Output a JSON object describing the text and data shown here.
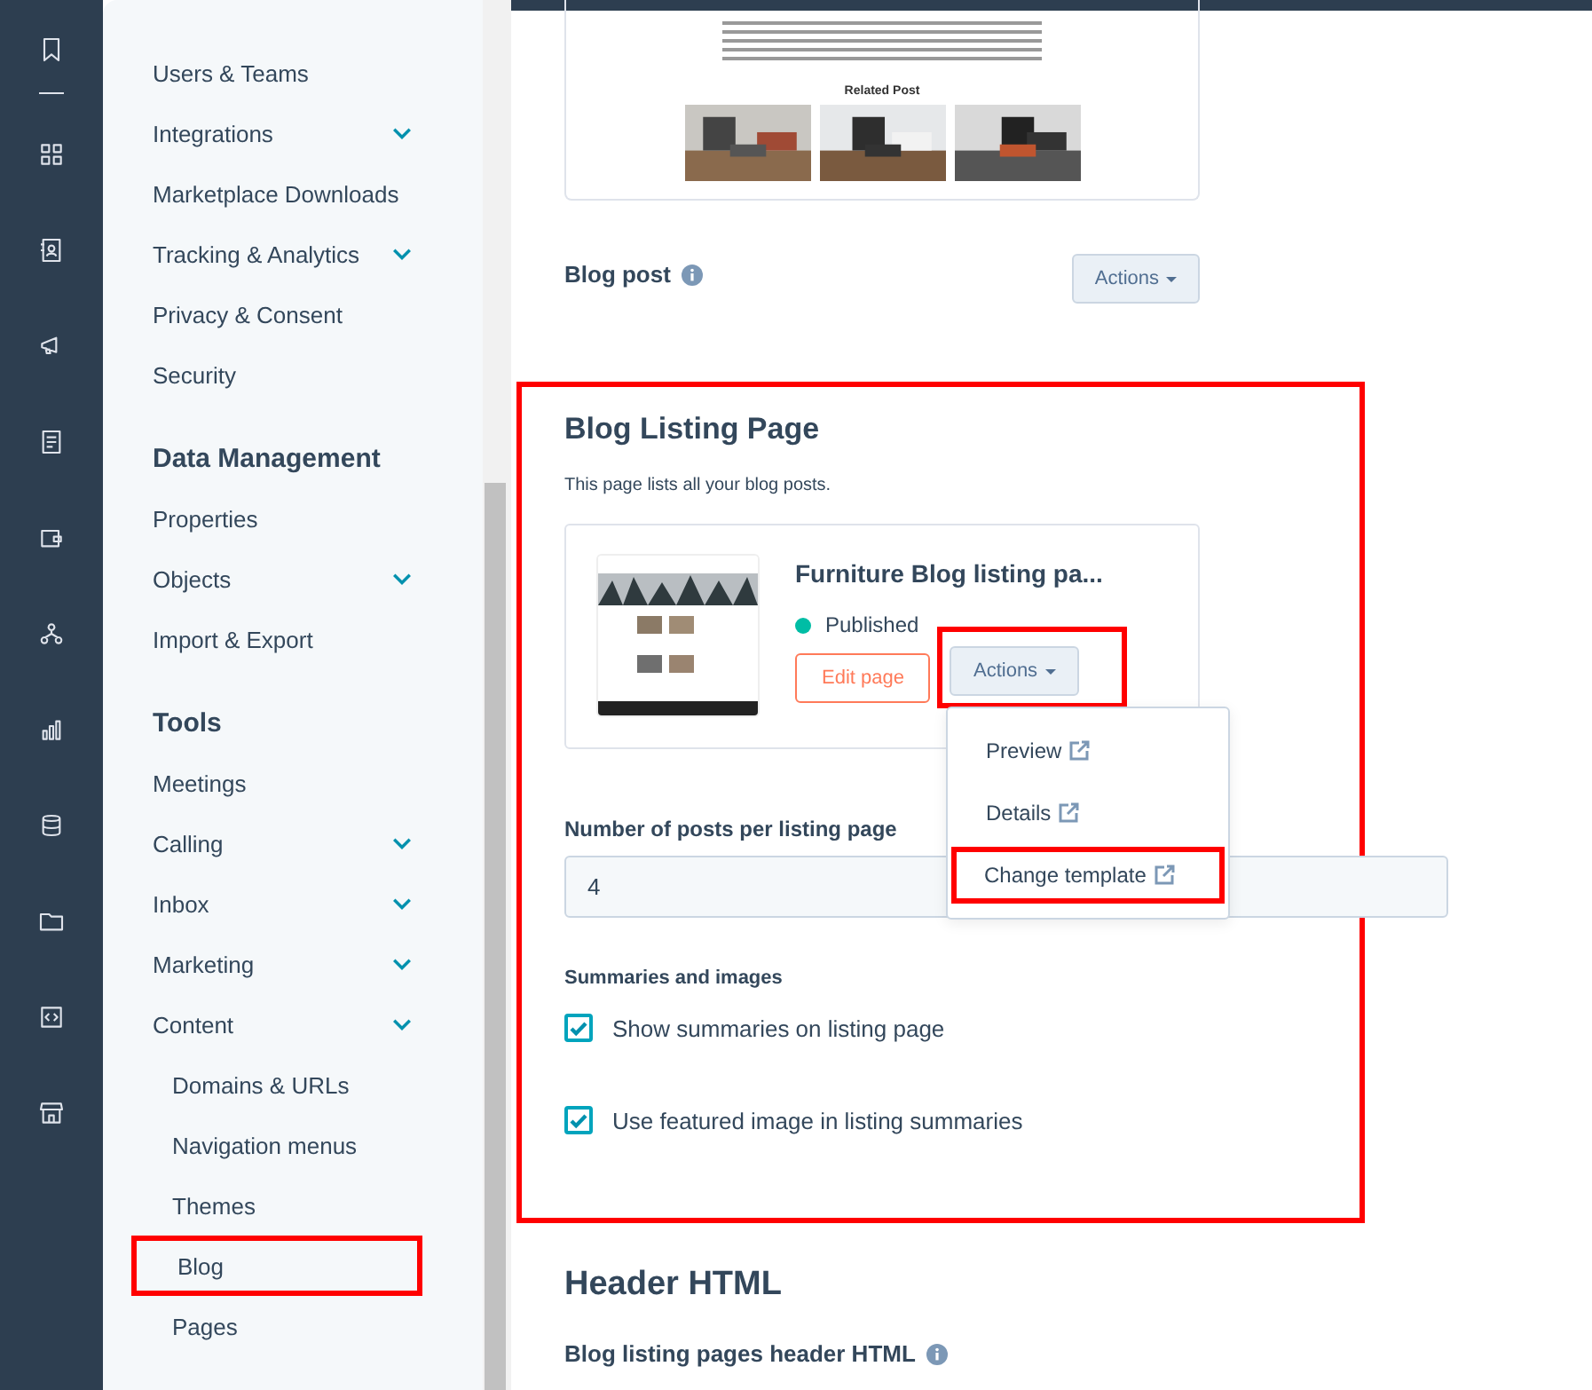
{
  "sidebar": {
    "sections": [
      {
        "items": [
          {
            "label": "Users & Teams",
            "expandable": false,
            "highlighted": false
          },
          {
            "label": "Integrations",
            "expandable": true,
            "highlighted": false
          },
          {
            "label": "Marketplace Downloads",
            "expandable": false,
            "highlighted": false
          },
          {
            "label": "Tracking & Analytics",
            "expandable": true,
            "highlighted": false
          },
          {
            "label": "Privacy & Consent",
            "expandable": false,
            "highlighted": false
          },
          {
            "label": "Security",
            "expandable": false,
            "highlighted": false
          }
        ]
      },
      {
        "heading": "Data Management",
        "items": [
          {
            "label": "Properties",
            "expandable": false,
            "highlighted": false
          },
          {
            "label": "Objects",
            "expandable": true,
            "highlighted": false
          },
          {
            "label": "Import & Export",
            "expandable": false,
            "highlighted": false
          }
        ]
      },
      {
        "heading": "Tools",
        "items": [
          {
            "label": "Meetings",
            "expandable": false,
            "highlighted": false
          },
          {
            "label": "Calling",
            "expandable": true,
            "highlighted": false
          },
          {
            "label": "Inbox",
            "expandable": true,
            "highlighted": false
          },
          {
            "label": "Marketing",
            "expandable": true,
            "highlighted": false
          },
          {
            "label": "Content",
            "expandable": true,
            "highlighted": false,
            "children": [
              {
                "label": "Domains & URLs",
                "highlighted": false
              },
              {
                "label": "Navigation menus",
                "highlighted": false
              },
              {
                "label": "Themes",
                "highlighted": false
              },
              {
                "label": "Blog",
                "highlighted": true
              },
              {
                "label": "Pages",
                "highlighted": false
              }
            ]
          }
        ]
      }
    ]
  },
  "blog_post": {
    "preview_heading": "Related Post",
    "label": "Blog post",
    "actions": "Actions"
  },
  "listing": {
    "title": "Blog Listing Page",
    "highlighted": true,
    "description": "This page lists all your blog posts.",
    "card": {
      "title": "Furniture Blog listing pa...",
      "status": "Published",
      "edit": "Edit page",
      "actions": "Actions",
      "actions_highlighted": true,
      "menu": [
        {
          "label": "Preview",
          "highlighted": false
        },
        {
          "label": "Details",
          "highlighted": false
        },
        {
          "label": "Change template",
          "highlighted": true
        }
      ]
    },
    "posts_label": "Number of posts per listing page",
    "posts_value": "4",
    "summaries_label": "Summaries and images",
    "options": [
      {
        "label": "Show summaries on listing page",
        "checked": true
      },
      {
        "label": "Use featured image in listing summaries",
        "checked": true
      }
    ]
  },
  "header_html": {
    "title": "Header HTML",
    "label": "Blog listing pages header HTML"
  }
}
